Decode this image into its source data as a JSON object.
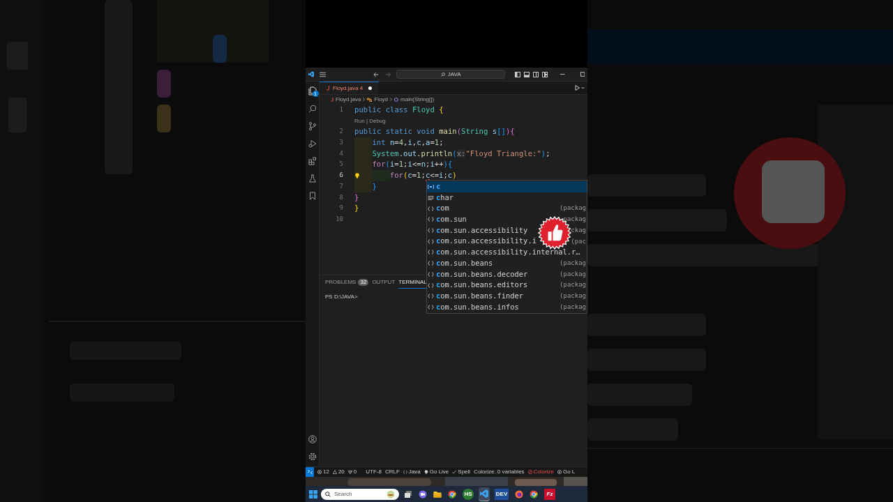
{
  "title_bar": {
    "search": "JAVA"
  },
  "activity_bar": {
    "explorer_badge": "1"
  },
  "tabs": [
    {
      "label": "Floyd.java 4",
      "selected": true,
      "modified": true
    }
  ],
  "breadcrumbs": [
    "Floyd.java",
    "Floyd",
    "main(String[])"
  ],
  "editor": {
    "lines": [
      {
        "number": "1",
        "tokens": [
          {
            "text": "public class ",
            "kind": "kw"
          },
          {
            "text": "Floyd ",
            "kind": "cls"
          },
          {
            "text": "{",
            "kind": "b1"
          }
        ]
      },
      {
        "kind": "codelens",
        "text": "Run | Debug"
      },
      {
        "number": "2",
        "tokens": [
          {
            "text": "public static void ",
            "kind": "kw"
          },
          {
            "text": "main",
            "kind": "fn"
          },
          {
            "text": "(",
            "kind": "b2"
          },
          {
            "text": "String ",
            "kind": "cls"
          },
          {
            "text": "s",
            "kind": "var"
          },
          {
            "text": "[]",
            "kind": "b3"
          },
          {
            "text": ")",
            "kind": "b2"
          },
          {
            "text": "{",
            "kind": "b2"
          }
        ]
      },
      {
        "number": "3",
        "indented": true,
        "tokens": [
          {
            "text": "int ",
            "kind": "kw"
          },
          {
            "text": "n",
            "kind": "var"
          },
          {
            "text": "="
          },
          {
            "text": "4",
            "kind": "num"
          },
          {
            "text": ","
          },
          {
            "text": "i",
            "kind": "var"
          },
          {
            "text": ","
          },
          {
            "text": "c",
            "kind": "var"
          },
          {
            "text": ","
          },
          {
            "text": "a",
            "kind": "var"
          },
          {
            "text": "="
          },
          {
            "text": "1",
            "kind": "num"
          },
          {
            "text": ";"
          }
        ]
      },
      {
        "number": "4",
        "indented": true,
        "tokens": [
          {
            "text": "System",
            "kind": "cls"
          },
          {
            "text": "."
          },
          {
            "text": "out",
            "kind": "var"
          },
          {
            "text": "."
          },
          {
            "text": "println",
            "kind": "fn"
          },
          {
            "text": "(",
            "kind": "b3"
          },
          {
            "text": "x:",
            "kind": "hint"
          },
          {
            "text": "\"Floyd Triangle:\"",
            "kind": "str"
          },
          {
            "text": ")",
            "kind": "b3"
          },
          {
            "text": ";"
          }
        ]
      },
      {
        "number": "5",
        "indented": true,
        "tokens": [
          {
            "text": "for",
            "kind": "ctrl"
          },
          {
            "text": "(",
            "kind": "b3"
          },
          {
            "text": "i",
            "kind": "var"
          },
          {
            "text": "="
          },
          {
            "text": "1",
            "kind": "num"
          },
          {
            "text": ";"
          },
          {
            "text": "i",
            "kind": "var"
          },
          {
            "text": "<="
          },
          {
            "text": "n",
            "kind": "var"
          },
          {
            "text": ";"
          },
          {
            "text": "i",
            "kind": "var"
          },
          {
            "text": "++"
          },
          {
            "text": ")",
            "kind": "b3"
          },
          {
            "text": "{",
            "kind": "b3"
          }
        ]
      },
      {
        "number": "6",
        "indented": true,
        "nested": true,
        "current": true,
        "lightbulb": true,
        "tokens": [
          {
            "text": "for",
            "kind": "ctrl"
          },
          {
            "text": "(",
            "kind": "b1"
          },
          {
            "text": "c",
            "kind": "var"
          },
          {
            "text": "="
          },
          {
            "text": "1",
            "kind": "num"
          },
          {
            "text": ";"
          },
          {
            "text": "c",
            "kind": "err"
          },
          {
            "text": "<="
          },
          {
            "text": "i",
            "kind": "var"
          },
          {
            "text": ";"
          },
          {
            "text": "c",
            "kind": "var"
          },
          {
            "text": ")",
            "kind": "b1"
          }
        ]
      },
      {
        "number": "7",
        "indented": true,
        "tokens": [
          {
            "text": "}",
            "kind": "b3"
          }
        ]
      },
      {
        "number": "8",
        "tokens": [
          {
            "text": "}",
            "kind": "b2"
          }
        ]
      },
      {
        "number": "9",
        "tokens": [
          {
            "text": "}",
            "kind": "b1"
          }
        ]
      },
      {
        "number": "10"
      }
    ]
  },
  "suggestions": [
    {
      "kind": "variable",
      "match": "c",
      "selected": true
    },
    {
      "kind": "keyword",
      "match": "c",
      "rest": "har",
      "selected": false
    },
    {
      "kind": "module",
      "match": "c",
      "rest": "om",
      "detail": "(packag",
      "selected": false
    },
    {
      "kind": "module",
      "match": "c",
      "rest": "om.sun",
      "detail": "packag",
      "selected": false
    },
    {
      "kind": "module",
      "match": "c",
      "rest": "om.sun.accessibility",
      "detail": "ckag",
      "selected": false
    },
    {
      "kind": "module",
      "match": "c",
      "rest": "om.sun.accessibility.i",
      "detail": "(pac",
      "selected": false
    },
    {
      "kind": "module",
      "match": "c",
      "rest": "om.sun.accessibility.internal.r…",
      "selected": false
    },
    {
      "kind": "module",
      "match": "c",
      "rest": "om.sun.beans",
      "detail": "(packag",
      "selected": false
    },
    {
      "kind": "module",
      "match": "c",
      "rest": "om.sun.beans.decoder",
      "detail": "(packag",
      "selected": false
    },
    {
      "kind": "module",
      "match": "c",
      "rest": "om.sun.beans.editors",
      "detail": "(packag",
      "selected": false
    },
    {
      "kind": "module",
      "match": "c",
      "rest": "om.sun.beans.finder",
      "detail": "(packag",
      "selected": false
    },
    {
      "kind": "module",
      "match": "c",
      "rest": "om.sun.beans.infos",
      "detail": "(packag",
      "selected": false
    }
  ],
  "panel": {
    "tabs": [
      {
        "label": "PROBLEMS",
        "badge": "32",
        "selected": false
      },
      {
        "label": "OUTPUT",
        "selected": false
      },
      {
        "label": "TERMINAL",
        "selected": true
      }
    ],
    "terminal": "PS D:\\JAVA>"
  },
  "status_bar": [
    {
      "kind": "errors",
      "text": "12"
    },
    {
      "kind": "warnings",
      "text": "20"
    },
    {
      "kind": "ports",
      "text": "0"
    },
    {
      "kind": "plain",
      "text": "UTF-8"
    },
    {
      "kind": "plain",
      "text": "CRLF"
    },
    {
      "kind": "language",
      "text": "Java"
    },
    {
      "kind": "live",
      "text": "Go Live"
    },
    {
      "kind": "check",
      "text": "Spell"
    },
    {
      "kind": "plain",
      "text": "Colorize: 0 variables"
    },
    {
      "kind": "off",
      "text": "Colorize"
    },
    {
      "kind": "play",
      "text": "Go L"
    }
  ],
  "taskbar": {
    "search": "Search",
    "apps": [
      {
        "kind": "taskview",
        "selected": false
      },
      {
        "kind": "chat",
        "selected": false
      },
      {
        "kind": "folder",
        "selected": false
      },
      {
        "kind": "chrome",
        "selected": false
      },
      {
        "kind": "hs",
        "label": "HS",
        "selected": false
      },
      {
        "kind": "vscode",
        "selected": true
      },
      {
        "kind": "dev",
        "label": "DEV",
        "selected": false
      },
      {
        "kind": "firefox",
        "selected": false
      },
      {
        "kind": "chrome",
        "selected": false
      },
      {
        "kind": "filezilla",
        "label": "Fz",
        "selected": false
      }
    ]
  }
}
